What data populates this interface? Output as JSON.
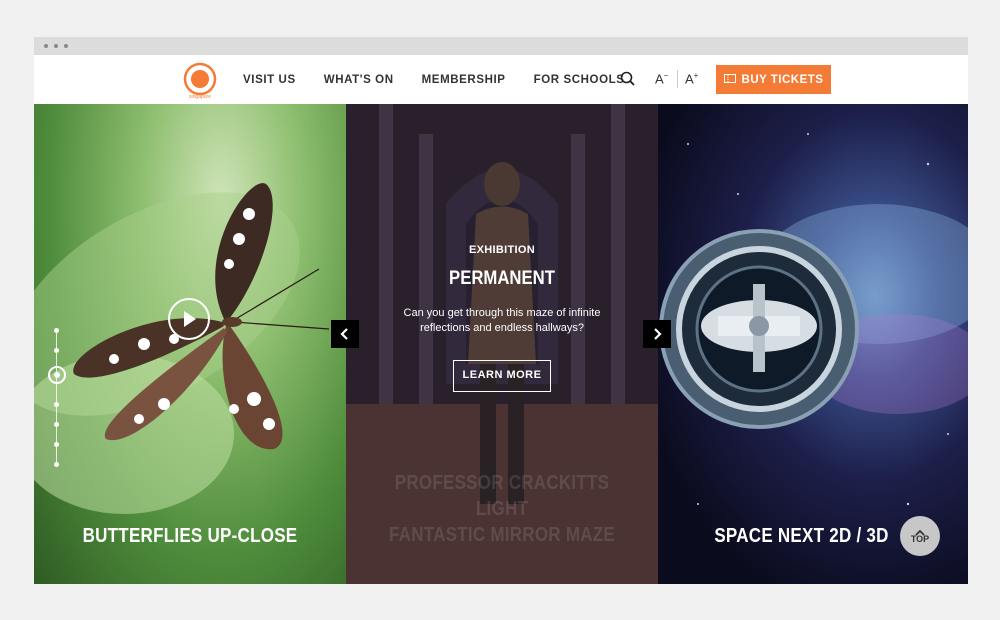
{
  "nav": {
    "logo_text": "SCIENCE CENTRE singapore",
    "links": [
      "VISIT US",
      "WHAT'S ON",
      "MEMBERSHIP",
      "FOR SCHOOLS"
    ],
    "font_small": "A",
    "font_large": "A",
    "buy_tickets": "BUY TICKETS"
  },
  "slides": [
    {
      "title": "BUTTERFLIES UP-CLOSE"
    },
    {
      "eyebrow": "EXHIBITION",
      "headline": "PERMANENT",
      "description": "Can you get through this maze of infinite reflections and endless hallways?",
      "cta": "LEARN MORE",
      "title_line1": "PROFESSOR CRACKITTS LIGHT",
      "title_line2": "FANTASTIC MIRROR MAZE"
    },
    {
      "title": "SPACE NEXT 2D / 3D"
    }
  ],
  "top_button": "TOP",
  "colors": {
    "accent": "#f47b35"
  }
}
